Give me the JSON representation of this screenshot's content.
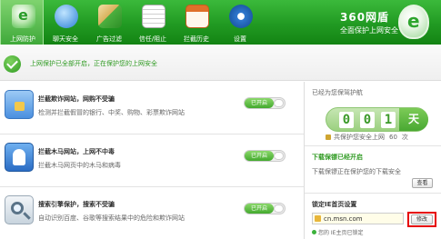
{
  "nav": {
    "items": [
      {
        "label": "上网防护",
        "icon": "e-shield-icon",
        "color": "#3fb53a"
      },
      {
        "label": "聊天安全",
        "icon": "chat-globe-icon",
        "color": "#2a7fd4"
      },
      {
        "label": "广告过滤",
        "icon": "broom-icon",
        "color": "#4caf3f"
      },
      {
        "label": "信任/阻止",
        "icon": "list-icon",
        "color": "#f0f0f0"
      },
      {
        "label": "拦截历史",
        "icon": "calendar-icon",
        "color": "#e0702a"
      },
      {
        "label": "设置",
        "icon": "gear-icon",
        "color": "#2f78cf"
      }
    ]
  },
  "brand": {
    "name": "360网盾",
    "slogan": "全面保护上网安全",
    "logo_letter": "e"
  },
  "status": {
    "text": "上网保护已全部开启，正在保护您的上网安全"
  },
  "features": [
    {
      "title": "拦截欺诈网站，网购不受骗",
      "desc": "检测并拦截假冒的银行、中奖、购物、彩票欺诈网站",
      "toggle": "已开启",
      "icon": "shield-lock-icon",
      "icon_color": "#4a8fdf"
    },
    {
      "title": "拦截木马网站，上网不中毒",
      "desc": "拦截木马网页中的木马和病毒",
      "toggle": "已开启",
      "icon": "horse-icon",
      "icon_color": "#3c7fd1"
    },
    {
      "title": "搜索引擎保护，搜索不受骗",
      "desc": "自动识别百度、谷歌等搜索结果中的危险和欺诈网站",
      "toggle": "已开启",
      "icon": "search-magnifier-icon",
      "icon_color": "#8aa2b8"
    }
  ],
  "sidebar": {
    "caption": "已经为您保驾护航",
    "digits": [
      "0",
      "0",
      "1"
    ],
    "day_unit": "天",
    "safe_prefix": "共保护您安全上网",
    "safe_count": "60",
    "safe_suffix": "次",
    "download_title": "下载保镖已经开启",
    "download_desc": "下载保镖正在保护您的下载安全",
    "view_button": "查看",
    "homepage_title": "锁定IE首页设置",
    "homepage_value": "cn.msn.com",
    "edit_button": "修改",
    "homepage_note": "您的 IE主页已锁定"
  }
}
